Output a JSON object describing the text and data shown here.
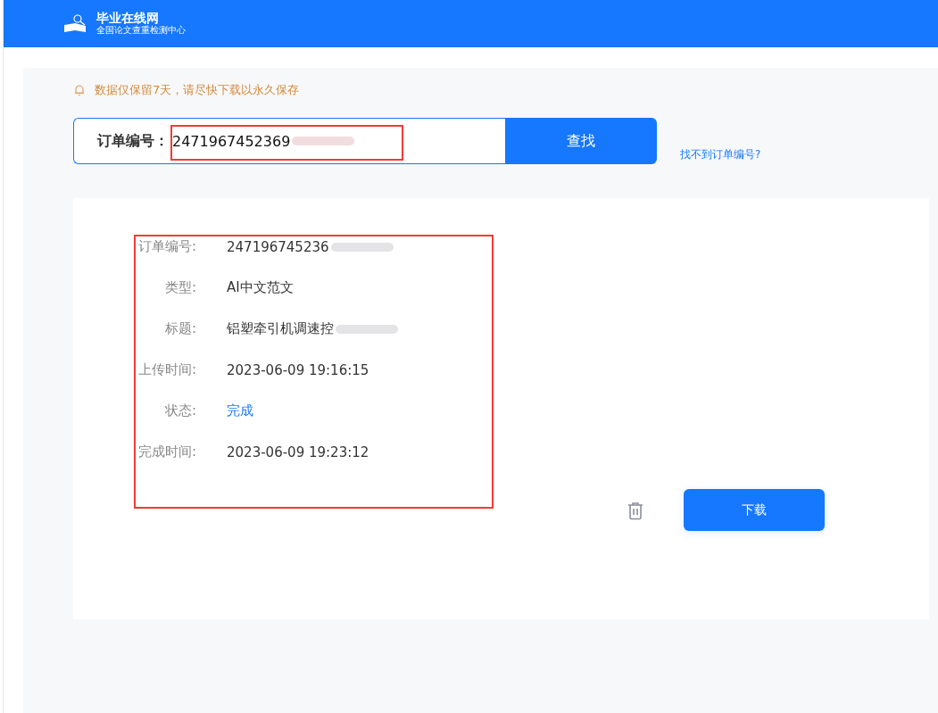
{
  "header": {
    "logo_title": "毕业在线网",
    "logo_subtitle": "全国论文查重检测中心"
  },
  "notice": "数据仅保留7天，请尽快下载以永久保存",
  "search": {
    "label": "订单编号：",
    "value": "2471967452369",
    "button": "查找",
    "help_link": "找不到订单编号?"
  },
  "details": [
    {
      "label": "订单编号:",
      "value": "247196745236",
      "kind": "plain"
    },
    {
      "label": "类型:",
      "value": "AI中文范文",
      "kind": "plain"
    },
    {
      "label": "标题:",
      "value": "铝塑牵引机调速控",
      "kind": "plain"
    },
    {
      "label": "上传时间:",
      "value": "2023-06-09 19:16:15",
      "kind": "plain"
    },
    {
      "label": "状态:",
      "value": "完成",
      "kind": "status"
    },
    {
      "label": "完成时间:",
      "value": "2023-06-09 19:23:12",
      "kind": "plain"
    }
  ],
  "actions": {
    "download": "下载"
  }
}
